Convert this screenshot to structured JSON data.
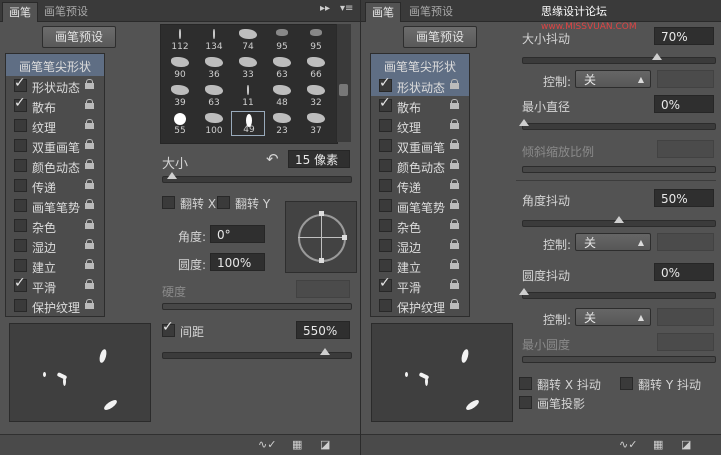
{
  "watermark": {
    "text": "思缘设计论坛",
    "url": "www.MISSVUAN.COM"
  },
  "left": {
    "tabs": [
      "画笔",
      "画笔预设"
    ],
    "preset_button": "画笔预设",
    "list_header": "画笔笔尖形状",
    "options": [
      {
        "label": "形状动态",
        "checked": true
      },
      {
        "label": "散布",
        "checked": true
      },
      {
        "label": "纹理",
        "checked": false
      },
      {
        "label": "双重画笔",
        "checked": false
      },
      {
        "label": "颜色动态",
        "checked": false
      },
      {
        "label": "传递",
        "checked": false
      },
      {
        "label": "画笔笔势",
        "checked": false
      },
      {
        "label": "杂色",
        "checked": false
      },
      {
        "label": "湿边",
        "checked": false
      },
      {
        "label": "建立",
        "checked": false
      },
      {
        "label": "平滑",
        "checked": true
      },
      {
        "label": "保护纹理",
        "checked": false
      }
    ],
    "brush_tips": [
      {
        "size": "112",
        "shape": "line"
      },
      {
        "size": "134",
        "shape": "line"
      },
      {
        "size": "74",
        "shape": "splat"
      },
      {
        "size": "95",
        "shape": "round"
      },
      {
        "size": "95",
        "shape": "round"
      },
      {
        "size": "90",
        "shape": "splat"
      },
      {
        "size": "36",
        "shape": "splat"
      },
      {
        "size": "33",
        "shape": "splat"
      },
      {
        "size": "63",
        "shape": "splat"
      },
      {
        "size": "66",
        "shape": "splat"
      },
      {
        "size": "39",
        "shape": "splat"
      },
      {
        "size": "63",
        "shape": "splat"
      },
      {
        "size": "11",
        "shape": "line"
      },
      {
        "size": "48",
        "shape": "splat"
      },
      {
        "size": "32",
        "shape": "splat"
      },
      {
        "size": "55",
        "shape": "circle"
      },
      {
        "size": "100",
        "shape": "splat"
      },
      {
        "size": "49",
        "shape": "ellipse"
      },
      {
        "size": "23",
        "shape": "splat"
      },
      {
        "size": "37",
        "shape": "splat"
      }
    ],
    "selected_tip": 17,
    "size_label": "大小",
    "size_value": "15 像素",
    "size_fraction": 0.05,
    "flip_x": "翻转 X",
    "flip_y": "翻转 Y",
    "angle_label": "角度:",
    "angle_value": "0°",
    "roundness_label": "圆度:",
    "roundness_value": "100%",
    "hardness_label": "硬度",
    "spacing_label": "间距",
    "spacing_checked": true,
    "spacing_value": "550%",
    "spacing_fraction": 0.86
  },
  "right": {
    "tabs": [
      "画笔",
      "画笔预设"
    ],
    "preset_button": "画笔预设",
    "list_header": "画笔笔尖形状",
    "options": [
      {
        "label": "形状动态",
        "checked": true,
        "active": true
      },
      {
        "label": "散布",
        "checked": true
      },
      {
        "label": "纹理",
        "checked": false
      },
      {
        "label": "双重画笔",
        "checked": false
      },
      {
        "label": "颜色动态",
        "checked": false
      },
      {
        "label": "传递",
        "checked": false
      },
      {
        "label": "画笔笔势",
        "checked": false
      },
      {
        "label": "杂色",
        "checked": false
      },
      {
        "label": "湿边",
        "checked": false
      },
      {
        "label": "建立",
        "checked": false
      },
      {
        "label": "平滑",
        "checked": true
      },
      {
        "label": "保护纹理",
        "checked": false
      }
    ],
    "size_jitter_label": "大小抖动",
    "size_jitter_value": "70%",
    "size_jitter_fraction": 0.7,
    "control_label": "控制:",
    "control_off": "关",
    "min_diameter_label": "最小直径",
    "min_diameter_value": "0%",
    "tilt_scale_label": "倾斜缩放比例",
    "angle_jitter_label": "角度抖动",
    "angle_jitter_value": "50%",
    "angle_jitter_fraction": 0.5,
    "roundness_jitter_label": "圆度抖动",
    "roundness_jitter_value": "0%",
    "min_roundness_label": "最小圆度",
    "flip_x_jitter": "翻转 X 抖动",
    "flip_y_jitter": "翻转 Y 抖动",
    "brush_projection": "画笔投影"
  }
}
